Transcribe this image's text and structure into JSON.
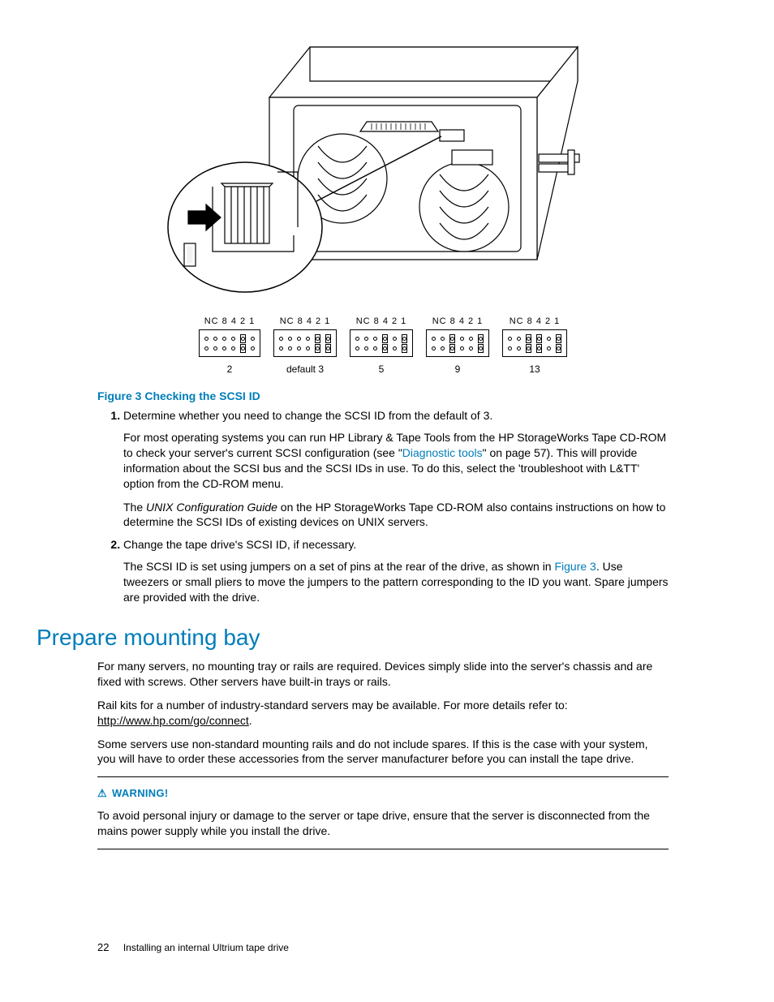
{
  "figure": {
    "caption": "Figure 3 Checking the SCSI ID",
    "header": "NC 8  4  2  1",
    "blocks": [
      {
        "label": "2"
      },
      {
        "label": "default 3"
      },
      {
        "label": "5"
      },
      {
        "label": "9"
      },
      {
        "label": "13"
      }
    ]
  },
  "steps": [
    {
      "lead": "Determine whether you need to change the SCSI ID from the default of 3.",
      "p1a": "For most operating systems you can run HP Library & Tape Tools from the HP StorageWorks Tape CD-ROM to check your server's current SCSI configuration (see \"",
      "p1link": "Diagnostic tools",
      "p1b": "\" on page 57). This will provide information about the SCSI bus and the SCSI IDs in use. To do this, select the 'troubleshoot with L&TT' option from the CD-ROM menu.",
      "p2a": "The ",
      "p2i": "UNIX Configuration Guide",
      "p2b": " on the HP StorageWorks Tape CD-ROM also contains instructions on how to determine the SCSI IDs of existing devices on UNIX servers."
    },
    {
      "lead": "Change the tape drive's SCSI ID, if necessary.",
      "p1a": "The SCSI ID is set using jumpers on a set of pins at the rear of the drive, as shown in ",
      "p1link": "Figure 3",
      "p1b": ". Use tweezers or small pliers to move the jumpers to the pattern corresponding to the ID you want. Spare jumpers are provided with the drive."
    }
  ],
  "section": {
    "title": "Prepare mounting bay",
    "p1": "For many servers, no mounting tray or rails are required. Devices simply slide into the server's chassis and are fixed with screws. Other servers have built-in trays or rails.",
    "p2a": "Rail kits for a number of industry-standard servers may be available. For more details refer to: ",
    "p2link": "http://www.hp.com/go/connect",
    "p2b": ".",
    "p3": "Some servers use non-standard mounting rails and do not include spares. If this is the case with your system, you will have to order these accessories from the server manufacturer before you can install the tape drive."
  },
  "warning": {
    "label": "WARNING!",
    "text": "To avoid personal injury or damage to the server or tape drive, ensure that the server is disconnected from the mains power supply while you install the drive."
  },
  "footer": {
    "page": "22",
    "title": "Installing an internal Ultrium tape drive"
  }
}
